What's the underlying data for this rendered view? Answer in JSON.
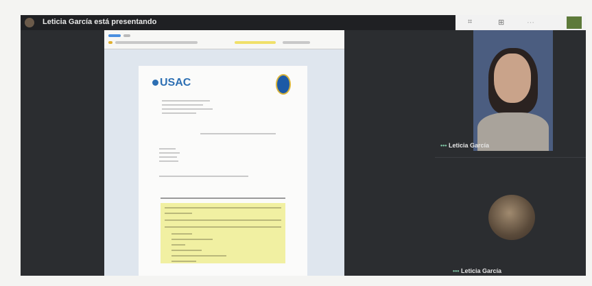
{
  "meeting": {
    "presenting_label": "Leticia García está presentando"
  },
  "controls": {
    "c1": "⌗",
    "c2": "⊞",
    "c3": "⋯"
  },
  "document": {
    "logo_text": "USAC"
  },
  "participants": [
    {
      "name": "Leticia García"
    },
    {
      "name": "Leticia García"
    }
  ],
  "colors": {
    "frame_bg": "#2b2d30",
    "accent_blue": "#2d6fb3",
    "highlight_yellow": "#f1f0a2"
  }
}
